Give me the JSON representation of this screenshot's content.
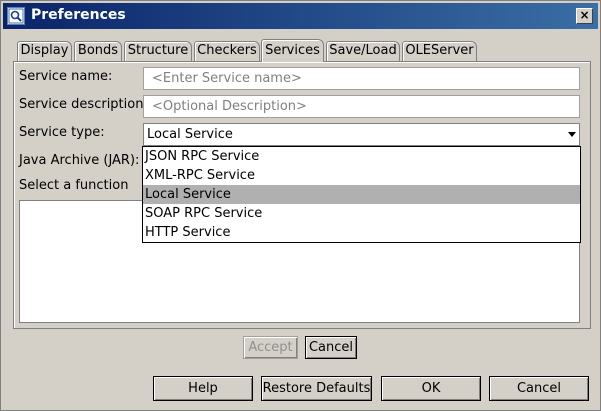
{
  "window": {
    "title": "Preferences",
    "close_glyph": "×"
  },
  "tabs": [
    {
      "label": "Display"
    },
    {
      "label": "Bonds"
    },
    {
      "label": "Structure"
    },
    {
      "label": "Checkers"
    },
    {
      "label": "Services",
      "active": true
    },
    {
      "label": "Save/Load"
    },
    {
      "label": "OLEServer"
    }
  ],
  "form": {
    "service_name_label": "Service name:",
    "service_name_placeholder": "<Enter Service name>",
    "service_description_label": "Service description:",
    "service_description_placeholder": "<Optional Description>",
    "service_type_label": "Service type:",
    "service_type_value": "Local Service",
    "jar_label": "Java Archive (JAR):",
    "function_label": "Select a function"
  },
  "dropdown_options": [
    {
      "label": "JSON RPC Service"
    },
    {
      "label": "XML-RPC Service"
    },
    {
      "label": "Local Service",
      "selected": true
    },
    {
      "label": "SOAP RPC Service"
    },
    {
      "label": "HTTP Service"
    }
  ],
  "panel_buttons": {
    "accept": "Accept",
    "cancel": "Cancel"
  },
  "dialog_buttons": {
    "help": "Help",
    "restore": "Restore Defaults",
    "ok": "OK",
    "cancel": "Cancel"
  }
}
